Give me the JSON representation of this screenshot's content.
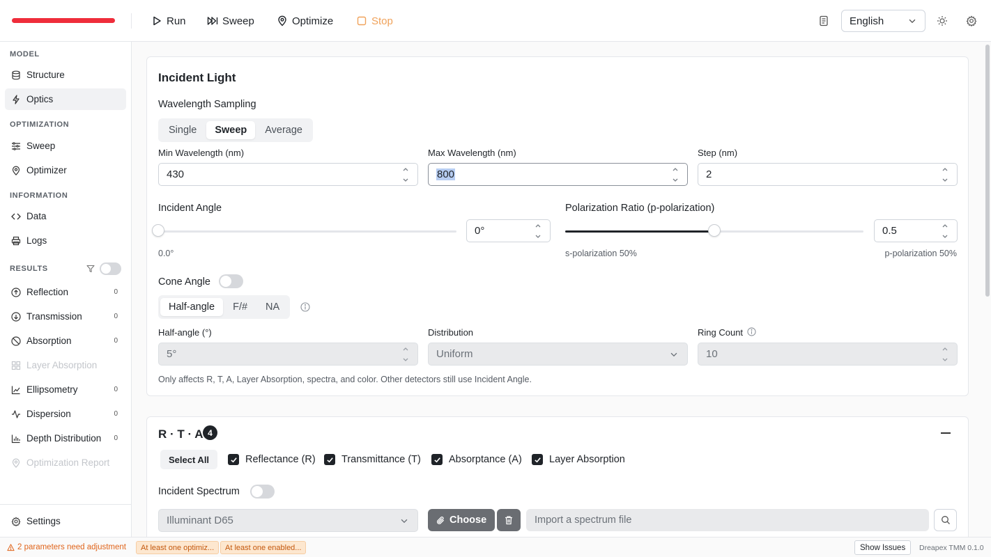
{
  "toolbar": {
    "run": "Run",
    "sweep": "Sweep",
    "optimize": "Optimize",
    "stop": "Stop",
    "language": "English"
  },
  "sidebar": {
    "sections": {
      "model": "MODEL",
      "optimization": "OPTIMIZATION",
      "information": "INFORMATION",
      "results": "RESULTS"
    },
    "items": {
      "structure": "Structure",
      "optics": "Optics",
      "sweep": "Sweep",
      "optimizer": "Optimizer",
      "data": "Data",
      "logs": "Logs",
      "reflection": "Reflection",
      "transmission": "Transmission",
      "absorption": "Absorption",
      "layer_absorption": "Layer Absorption",
      "ellipsometry": "Ellipsometry",
      "dispersion": "Dispersion",
      "depth_distribution": "Depth Distribution",
      "optimization_report": "Optimization Report",
      "settings": "Settings"
    },
    "badges": {
      "reflection": "0",
      "transmission": "0",
      "absorption": "0",
      "ellipsometry": "0",
      "dispersion": "0",
      "depth_distribution": "0"
    }
  },
  "incident_light": {
    "title": "Incident Light",
    "wavelength_sampling": "Wavelength Sampling",
    "sampling_modes": [
      "Single",
      "Sweep",
      "Average"
    ],
    "min_wavelength_label": "Min Wavelength (nm)",
    "min_wavelength": "430",
    "max_wavelength_label": "Max Wavelength (nm)",
    "max_wavelength": "800",
    "step_label": "Step (nm)",
    "step": "2",
    "incident_angle_label": "Incident Angle",
    "incident_angle_value": "0°",
    "incident_angle_readout": "0.0°",
    "incident_angle_fraction": 0,
    "polarization_label": "Polarization Ratio (p-polarization)",
    "polarization_value": "0.5",
    "polarization_fraction": 0.5,
    "s_pol_label": "s-polarization 50%",
    "p_pol_label": "p-polarization 50%",
    "cone_angle_label": "Cone Angle",
    "cone_modes": [
      "Half-angle",
      "F/#",
      "NA"
    ],
    "half_angle_label": "Half-angle (°)",
    "half_angle_value": "5°",
    "distribution_label": "Distribution",
    "distribution_value": "Uniform",
    "ring_count_label": "Ring Count",
    "ring_count_value": "10",
    "note": "Only affects R, T, A, Layer Absorption, spectra, and color. Other detectors still use Incident Angle."
  },
  "rta": {
    "title": "R · T · A",
    "count": "4",
    "select_all": "Select All",
    "checks": [
      "Reflectance (R)",
      "Transmittance (T)",
      "Absorptance (A)",
      "Layer Absorption"
    ],
    "incident_spectrum_label": "Incident Spectrum",
    "spectrum_value": "Illuminant D65",
    "choose_label": "Choose",
    "file_placeholder": "Import a spectrum file"
  },
  "statusbar": {
    "warning": "2 parameters need adjustment",
    "chip1": "At least one optimiz...",
    "chip2": "At least one enabled...",
    "show_issues": "Show Issues",
    "version": "Dreapex TMM 0.1.0"
  },
  "colors": {
    "logo_accent": "#ef2d3b",
    "stop": "#f0a25a",
    "warning": "#e0651c"
  }
}
